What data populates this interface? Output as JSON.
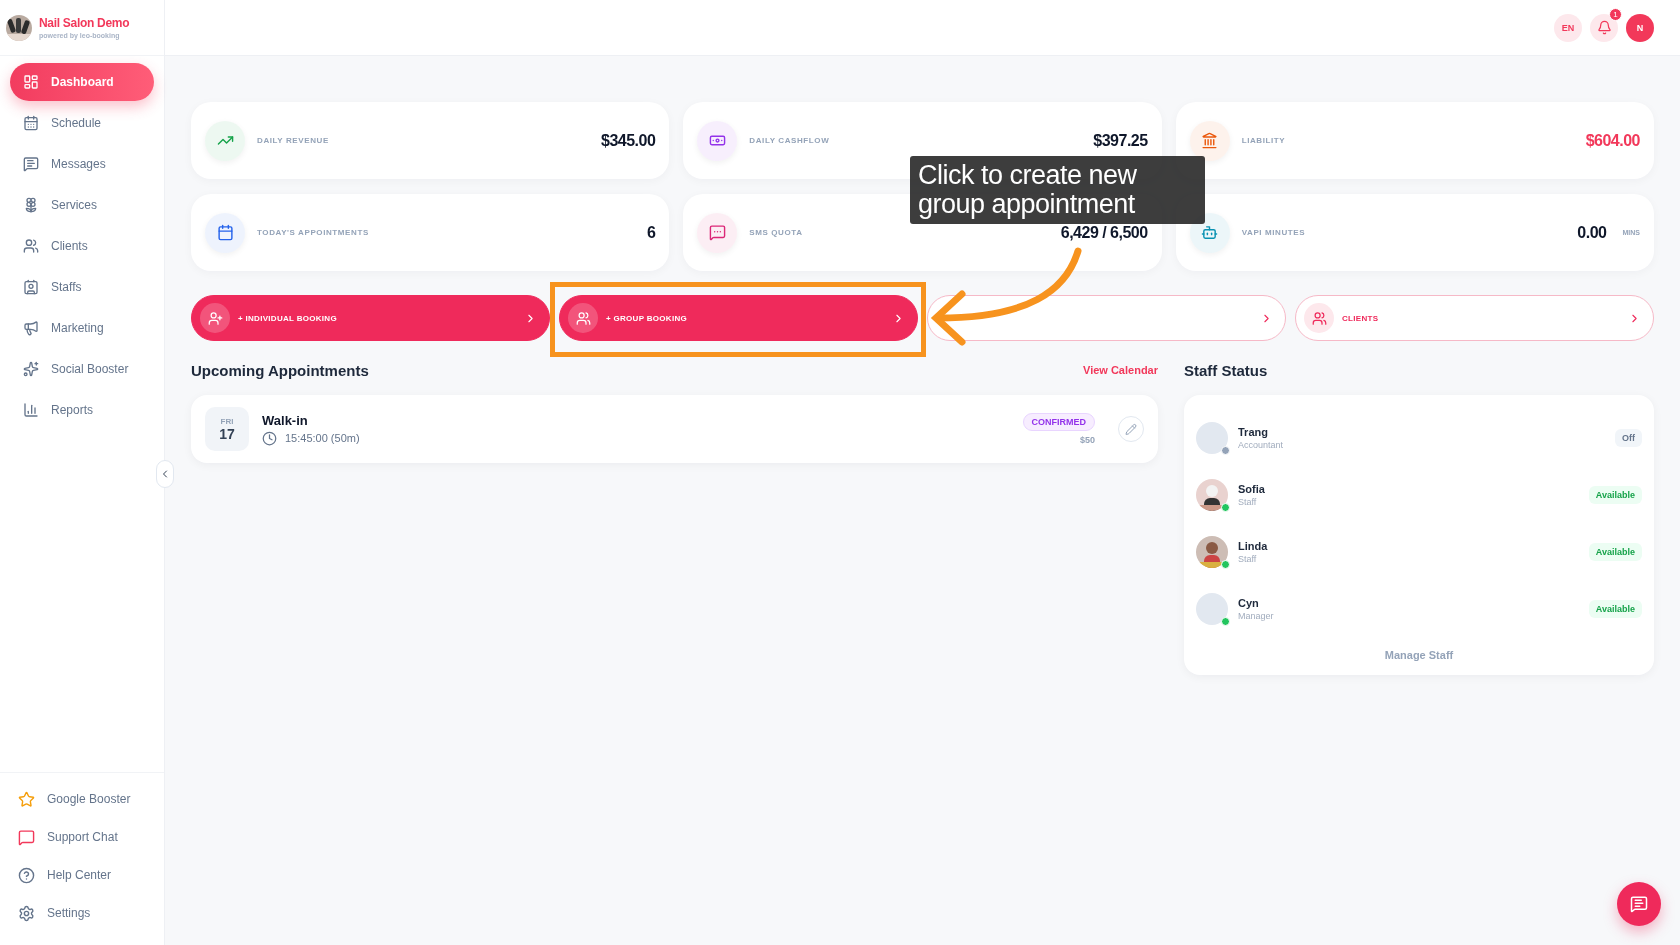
{
  "brand": {
    "name": "Nail Salon Demo",
    "tagline": "powered by leo-booking"
  },
  "sidebar": {
    "items": [
      {
        "label": "Dashboard",
        "selected": true
      },
      {
        "label": "Schedule",
        "selected": false
      },
      {
        "label": "Messages",
        "selected": false
      },
      {
        "label": "Services",
        "selected": false
      },
      {
        "label": "Clients",
        "selected": false
      },
      {
        "label": "Staffs",
        "selected": false
      },
      {
        "label": "Marketing",
        "selected": false
      },
      {
        "label": "Social Booster",
        "selected": false
      },
      {
        "label": "Reports",
        "selected": false
      }
    ],
    "footer_items": [
      {
        "label": "Google Booster"
      },
      {
        "label": "Support Chat"
      },
      {
        "label": "Help Center"
      },
      {
        "label": "Settings"
      }
    ]
  },
  "header": {
    "language": "EN",
    "notification_count": "1",
    "user_initial": "N"
  },
  "stats": [
    {
      "label": "DAILY REVENUE",
      "value": "$345.00",
      "color": "#16a34a",
      "negative": false
    },
    {
      "label": "DAILY CASHFLOW",
      "value": "$397.25",
      "color": "#9333ea",
      "negative": false
    },
    {
      "label": "LIABILITY",
      "value": "$604.00",
      "color": "#ea580c",
      "negative": true
    },
    {
      "label": "TODAY'S APPOINTMENTS",
      "value": "6",
      "color": "#2563eb",
      "negative": false
    },
    {
      "label": "SMS QUOTA",
      "value": "6,429 / 6,500",
      "color": "#db2777",
      "negative": false
    },
    {
      "label": "VAPI MINUTES",
      "value": "0.00",
      "unit": "MINS",
      "color": "#0891b2",
      "negative": false
    }
  ],
  "actions": [
    {
      "label": "+ INDIVIDUAL BOOKING",
      "kind": "filled"
    },
    {
      "label": "+ GROUP BOOKING",
      "kind": "filled"
    },
    {
      "kind": "outline"
    },
    {
      "label": "CLIENTS",
      "kind": "outline"
    }
  ],
  "appointments": {
    "title": "Upcoming Appointments",
    "link": "View Calendar",
    "items": [
      {
        "weekday": "FRI",
        "day": "17",
        "name": "Walk-in",
        "time": "15:45:00 (50m)",
        "status": "CONFIRMED",
        "price": "$50"
      }
    ]
  },
  "staff_status": {
    "title": "Staff Status",
    "footer": "Manage Staff",
    "items": [
      {
        "name": "Trang",
        "role": "Accountant",
        "status": "Off",
        "available": false,
        "photo": false
      },
      {
        "name": "Sofia",
        "role": "Staff",
        "status": "Available",
        "available": true,
        "photo": true
      },
      {
        "name": "Linda",
        "role": "Staff",
        "status": "Available",
        "available": true,
        "photo": true
      },
      {
        "name": "Cyn",
        "role": "Manager",
        "status": "Available",
        "available": true,
        "photo": false
      }
    ]
  },
  "tooltip": {
    "text": "Click to create new group appointment"
  }
}
